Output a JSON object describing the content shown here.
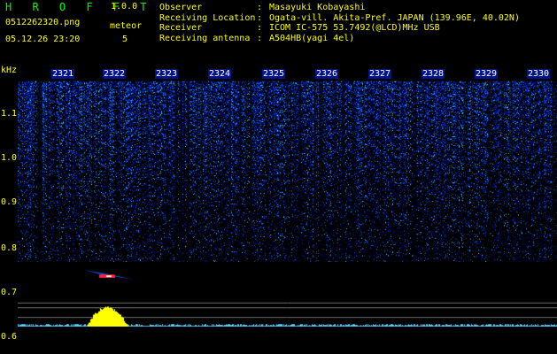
{
  "app": {
    "title": "H R O F F T",
    "version": "1.0.0"
  },
  "capture": {
    "filename": "0512262320.png",
    "mode_label": "meteor",
    "datetime": "05.12.26 23:20",
    "count": "5"
  },
  "info": [
    {
      "key": "Observer",
      "sep": ":",
      "value": "Masayuki Kobayashi"
    },
    {
      "key": "Receiving Location",
      "sep": ":",
      "value": "Ogata-vill. Akita-Pref. JAPAN (139.96E, 40.02N)"
    },
    {
      "key": "Receiver",
      "sep": ":",
      "value": "ICOM IC-575 53.7492(@LCD)MHz USB"
    },
    {
      "key": "Receiving antenna",
      "sep": ":",
      "value": "A504HB(yagi 4el)"
    }
  ],
  "y_axis": {
    "unit": "kHz",
    "ticks": [
      "1.1",
      "1.0",
      "0.9",
      "0.8",
      "0.7",
      "0.6"
    ]
  },
  "x_axis": {
    "ticks": [
      "2321",
      "2322",
      "2323",
      "2324",
      "2325",
      "2326",
      "2327",
      "2328",
      "2329",
      "2330"
    ]
  },
  "colors": {
    "background": "#000000",
    "noise_low": "#0010a0",
    "noise_mid": "#0060ff",
    "noise_high": "#40d0ff",
    "meteor": "#ff2040",
    "spectrum": "#ffff00",
    "label": "#ffff00",
    "title": "#00ff00"
  }
}
